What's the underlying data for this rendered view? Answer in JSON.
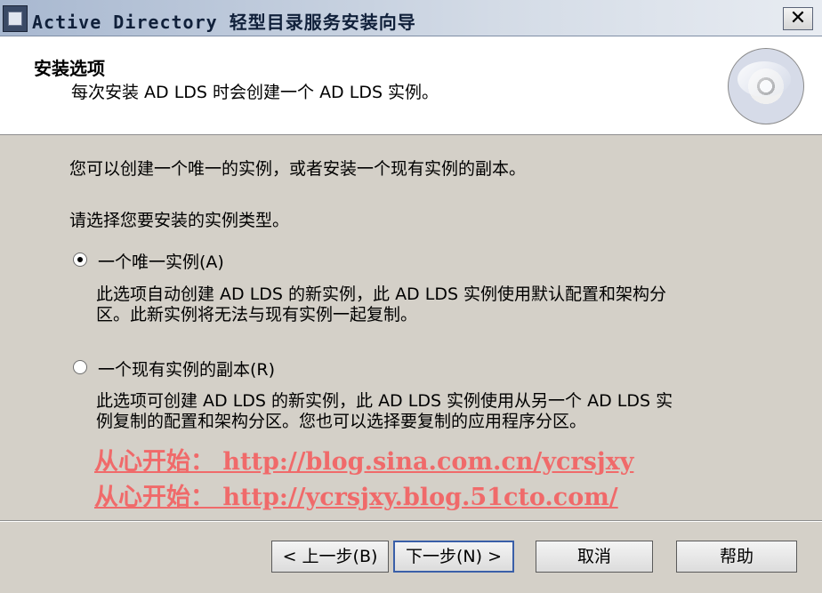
{
  "window": {
    "title": "Active Directory 轻型目录服务安装向导",
    "close_label": "✕"
  },
  "header": {
    "title": "安装选项",
    "subtitle": "每次安装 AD LDS 时会创建一个 AD LDS 实例。"
  },
  "main": {
    "intro": "您可以创建一个唯一的实例，或者安装一个现有实例的副本。",
    "prompt": "请选择您要安装的实例类型。",
    "options": [
      {
        "label": "一个唯一实例(A)",
        "desc_line1": "此选项自动创建 AD LDS 的新实例，此 AD LDS 实例使用默认配置和架构分",
        "desc_line2": "区。此新实例将无法与现有实例一起复制。",
        "selected": true
      },
      {
        "label": "一个现有实例的副本(R)",
        "desc_line1": "此选项可创建 AD LDS 的新实例，此 AD LDS 实例使用从另一个 AD LDS 实",
        "desc_line2": "例复制的配置和架构分区。您也可以选择要复制的应用程序分区。",
        "selected": false
      }
    ]
  },
  "watermark": {
    "line1": "从心开始： http://blog.sina.com.cn/ycrsjxy",
    "line2": "从心开始： http://ycrsjxy.blog.51cto.com/"
  },
  "buttons": {
    "back": "< 上一步(B)",
    "next": "下一步(N) >",
    "cancel": "取消",
    "help": "帮助"
  },
  "colors": {
    "titlebar": "#a8b8d0",
    "dialog_bg": "#d4d0c8",
    "watermark": "#f06a6a"
  }
}
